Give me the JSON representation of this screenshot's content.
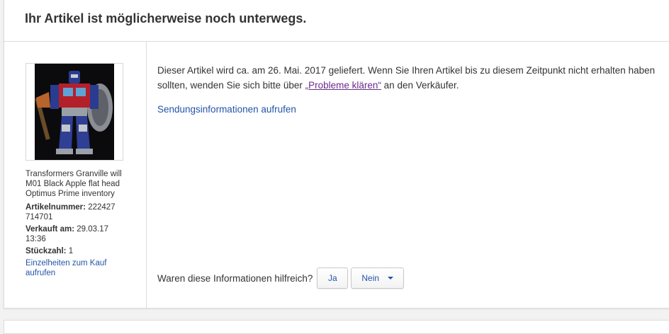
{
  "header": {
    "title": "Ihr Artikel ist möglicherweise noch unterwegs."
  },
  "item": {
    "title": "Transformers Granville will M01 Black Apple flat head Optimus Prime inventory",
    "item_number_label": "Artikelnummer:",
    "item_number": "222427 714701",
    "sold_label": "Verkauft am:",
    "sold_date": "29.03.17 13:36",
    "qty_label": "Stückzahl:",
    "qty": "1",
    "details_link": "Einzelheiten zum Kauf aufrufen"
  },
  "delivery": {
    "text_before": "Dieser Artikel wird ca. am 26. Mai. 2017 geliefert. Wenn Sie Ihren Artikel bis zu diesem Zeitpunkt nicht erhalten haben sollten, wenden Sie sich bitte über ",
    "link_text": "„Probleme klären“",
    "text_after": " an den Verkäufer.",
    "shipping_link": "Sendungsinformationen aufrufen"
  },
  "feedback": {
    "question": "Waren diese Informationen hilfreich?",
    "yes_label": "Ja",
    "no_label": "Nein"
  },
  "colors": {
    "link": "#2454a8",
    "visited_link": "#6a2b8a"
  }
}
